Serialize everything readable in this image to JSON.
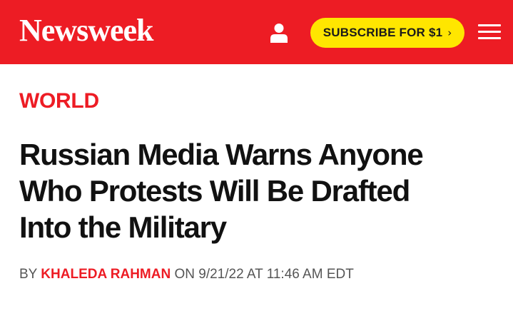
{
  "header": {
    "logo_text": "Newsweek",
    "subscribe_label": "SUBSCRIBE FOR $1",
    "colors": {
      "brand_red": "#ed1c24",
      "subscribe_yellow": "#ffe600"
    },
    "icons": {
      "account": "user-icon",
      "subscribe_arrow": "chevron-right-icon",
      "menu": "hamburger-menu-icon"
    }
  },
  "article": {
    "section": "WORLD",
    "headline_lines": [
      "Russian Media Warns Anyone",
      "Who Protests Will Be Drafted",
      "Into the Military"
    ],
    "byline": {
      "prefix": "BY",
      "author": "KHALEDA RAHMAN",
      "date_text": "ON 9/21/22 AT 11:46 AM EDT"
    }
  }
}
